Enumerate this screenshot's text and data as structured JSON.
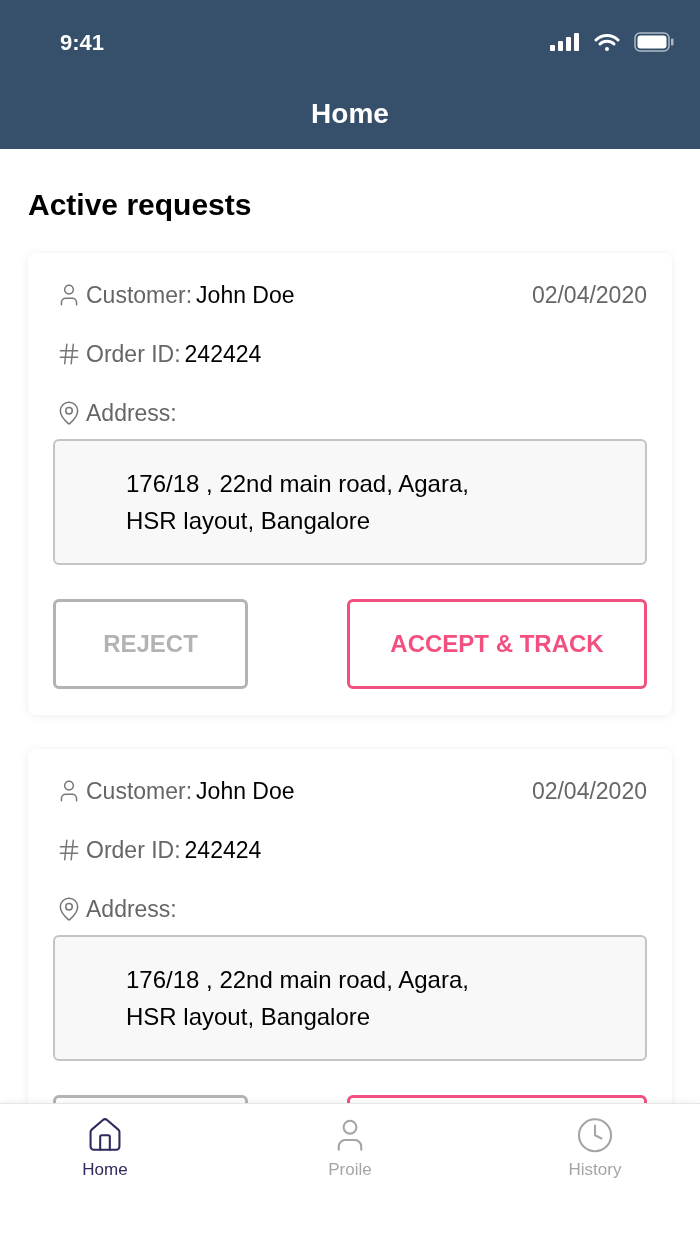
{
  "status_bar": {
    "time": "9:41"
  },
  "header": {
    "title": "Home"
  },
  "section_title": "Active requests",
  "requests": [
    {
      "customer_label": "Customer:",
      "customer": "John Doe",
      "date": "02/04/2020",
      "order_label": "Order ID:",
      "order_id": "242424",
      "address_label": "Address:",
      "address": [
        "176/18 , 22nd main road, Agara,",
        "HSR layout, Bangalore"
      ],
      "buttons": [
        {
          "kind": "reject",
          "label": "REJECT"
        },
        {
          "kind": "accept",
          "label": "ACCEPT & TRACK"
        }
      ]
    },
    {
      "customer_label": "Customer:",
      "customer": "John Doe",
      "date": "02/04/2020",
      "order_label": "Order ID:",
      "order_id": "242424",
      "address_label": "Address:",
      "address": [
        "176/18 , 22nd main road, Agara,",
        "HSR layout, Bangalore"
      ],
      "buttons": [
        {
          "kind": "reject"
        },
        {
          "kind": "accept"
        }
      ]
    }
  ],
  "tab_bar": [
    {
      "kind": "home",
      "label": "Home",
      "selected": true
    },
    {
      "kind": "profile",
      "label": "Proile",
      "selected": false
    },
    {
      "kind": "history",
      "label": "History",
      "selected": false
    }
  ]
}
